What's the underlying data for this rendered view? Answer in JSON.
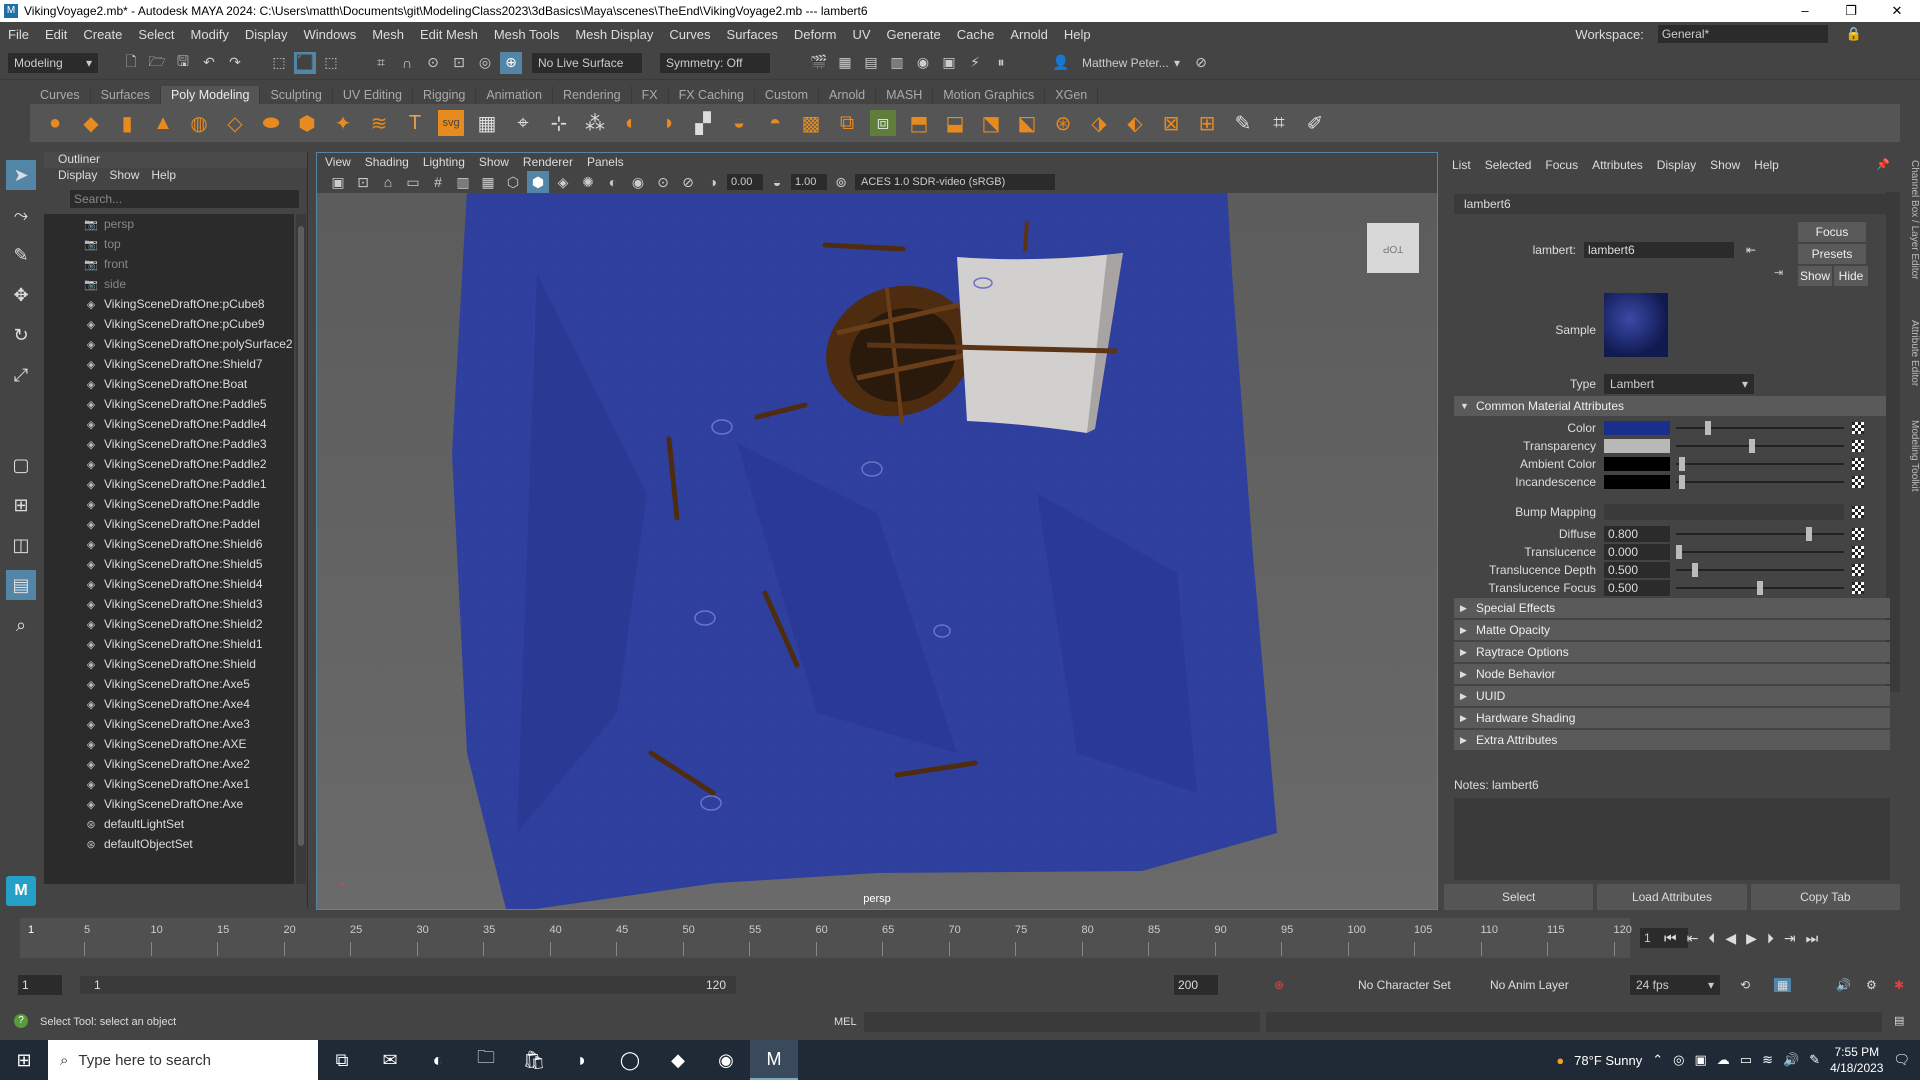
{
  "titlebar": {
    "app_icon": "maya-icon",
    "title": "VikingVoyage2.mb* - Autodesk MAYA 2024: C:\\Users\\matth\\Documents\\git\\ModelingClass2023\\3dBasics\\Maya\\scenes\\TheEnd\\VikingVoyage2.mb   ---   lambert6",
    "minimize": "–",
    "maximize": "❐",
    "close": "✕"
  },
  "menubar": {
    "items": [
      "File",
      "Edit",
      "Create",
      "Select",
      "Modify",
      "Display",
      "Windows",
      "Mesh",
      "Edit Mesh",
      "Mesh Tools",
      "Mesh Display",
      "Curves",
      "Surfaces",
      "Deform",
      "UV",
      "Generate",
      "Cache",
      "Arnold",
      "Help"
    ],
    "workspace_label": "Workspace:",
    "workspace_value": "General*"
  },
  "statusline": {
    "mode": "Modeling",
    "live_surface": "No Live Surface",
    "symmetry": "Symmetry: Off",
    "user": "Matthew Peter..."
  },
  "shelf": {
    "tabs": [
      "Curves",
      "Surfaces",
      "Poly Modeling",
      "Sculpting",
      "UV Editing",
      "Rigging",
      "Animation",
      "Rendering",
      "FX",
      "FX Caching",
      "Custom",
      "Arnold",
      "MASH",
      "Motion Graphics",
      "XGen"
    ],
    "active_tab": "Poly Modeling",
    "text_tool": "T",
    "svg_tool": "svg"
  },
  "outliner": {
    "title": "Outliner",
    "menu": [
      "Display",
      "Show",
      "Help"
    ],
    "search_placeholder": "Search...",
    "items": [
      {
        "label": "persp",
        "type": "camera"
      },
      {
        "label": "top",
        "type": "camera"
      },
      {
        "label": "front",
        "type": "camera"
      },
      {
        "label": "side",
        "type": "camera"
      },
      {
        "label": "VikingSceneDraftOne:pCube8",
        "type": "mesh"
      },
      {
        "label": "VikingSceneDraftOne:pCube9",
        "type": "mesh"
      },
      {
        "label": "VikingSceneDraftOne:polySurface2",
        "type": "mesh"
      },
      {
        "label": "VikingSceneDraftOne:Shield7",
        "type": "mesh"
      },
      {
        "label": "VikingSceneDraftOne:Boat",
        "type": "mesh"
      },
      {
        "label": "VikingSceneDraftOne:Paddle5",
        "type": "mesh"
      },
      {
        "label": "VikingSceneDraftOne:Paddle4",
        "type": "mesh"
      },
      {
        "label": "VikingSceneDraftOne:Paddle3",
        "type": "mesh"
      },
      {
        "label": "VikingSceneDraftOne:Paddle2",
        "type": "mesh"
      },
      {
        "label": "VikingSceneDraftOne:Paddle1",
        "type": "mesh"
      },
      {
        "label": "VikingSceneDraftOne:Paddle",
        "type": "mesh"
      },
      {
        "label": "VikingSceneDraftOne:Paddel",
        "type": "mesh"
      },
      {
        "label": "VikingSceneDraftOne:Shield6",
        "type": "mesh"
      },
      {
        "label": "VikingSceneDraftOne:Shield5",
        "type": "mesh"
      },
      {
        "label": "VikingSceneDraftOne:Shield4",
        "type": "mesh"
      },
      {
        "label": "VikingSceneDraftOne:Shield3",
        "type": "mesh"
      },
      {
        "label": "VikingSceneDraftOne:Shield2",
        "type": "mesh"
      },
      {
        "label": "VikingSceneDraftOne:Shield1",
        "type": "mesh"
      },
      {
        "label": "VikingSceneDraftOne:Shield",
        "type": "mesh"
      },
      {
        "label": "VikingSceneDraftOne:Axe5",
        "type": "mesh"
      },
      {
        "label": "VikingSceneDraftOne:Axe4",
        "type": "mesh"
      },
      {
        "label": "VikingSceneDraftOne:Axe3",
        "type": "mesh"
      },
      {
        "label": "VikingSceneDraftOne:AXE",
        "type": "mesh"
      },
      {
        "label": "VikingSceneDraftOne:Axe2",
        "type": "mesh"
      },
      {
        "label": "VikingSceneDraftOne:Axe1",
        "type": "mesh"
      },
      {
        "label": "VikingSceneDraftOne:Axe",
        "type": "mesh"
      },
      {
        "label": "defaultLightSet",
        "type": "set"
      },
      {
        "label": "defaultObjectSet",
        "type": "set"
      }
    ]
  },
  "viewport": {
    "menu": [
      "View",
      "Shading",
      "Lighting",
      "Show",
      "Renderer",
      "Panels"
    ],
    "exposure": "0.00",
    "gamma": "1.00",
    "color_space": "ACES 1.0 SDR-video (sRGB)",
    "camera_label": "persp",
    "viewcube_label": "TOP",
    "ocean_color": "#2f3f9e",
    "sail_color": "#d2cfcf",
    "wood_color": "#5a3414"
  },
  "attribute_editor": {
    "menu": [
      "List",
      "Selected",
      "Focus",
      "Attributes",
      "Display",
      "Show",
      "Help"
    ],
    "node_tab": "lambert6",
    "node_type_label": "lambert:",
    "node_name": "lambert6",
    "focus_btn": "Focus",
    "presets_btn": "Presets",
    "show_btn": "Show",
    "hide_btn": "Hide",
    "sample_label": "Sample",
    "type_label": "Type",
    "type_value": "Lambert",
    "common_section": "Common Material Attributes",
    "swatches": [
      {
        "label": "Color",
        "color": "#1a2e8c",
        "level": 0.18
      },
      {
        "label": "Transparency",
        "color": "#b8b8b8",
        "level": 0.45
      },
      {
        "label": "Ambient Color",
        "color": "#000000",
        "level": 0.02
      },
      {
        "label": "Incandescence",
        "color": "#000000",
        "level": 0.02
      }
    ],
    "bump_label": "Bump Mapping",
    "numeric": [
      {
        "label": "Diffuse",
        "value": "0.800",
        "level": 0.8
      },
      {
        "label": "Translucence",
        "value": "0.000",
        "level": 0.0
      },
      {
        "label": "Translucence Depth",
        "value": "0.500",
        "level": 0.1
      },
      {
        "label": "Translucence Focus",
        "value": "0.500",
        "level": 0.5
      }
    ],
    "sections": [
      "Special Effects",
      "Matte Opacity",
      "Raytrace Options",
      "Node Behavior",
      "UUID",
      "Hardware Shading",
      "Extra Attributes"
    ],
    "notes_label": "Notes:  lambert6",
    "buttons": [
      "Select",
      "Load Attributes",
      "Copy Tab"
    ],
    "side_tabs": [
      "Channel Box / Layer Editor",
      "Attribute Editor",
      "Modeling Toolkit"
    ]
  },
  "timeslider": {
    "ticks": [
      "5",
      "10",
      "15",
      "20",
      "25",
      "30",
      "35",
      "40",
      "45",
      "50",
      "55",
      "60",
      "65",
      "70",
      "75",
      "80",
      "85",
      "90",
      "95",
      "100",
      "105",
      "110",
      "115",
      "120"
    ],
    "current_frame_marker": "1",
    "current_frame": "1"
  },
  "range": {
    "start": "1",
    "inner_start": "1",
    "inner_end": "120",
    "end": "200",
    "character_set": "No Character Set",
    "anim_layer": "No Anim Layer",
    "fps": "24 fps"
  },
  "helpline": {
    "message": "Select Tool: select an object",
    "mel_label": "MEL"
  },
  "taskbar": {
    "search_placeholder": "Type here to search",
    "weather": "78°F  Sunny",
    "time": "7:55 PM",
    "date": "4/18/2023"
  }
}
